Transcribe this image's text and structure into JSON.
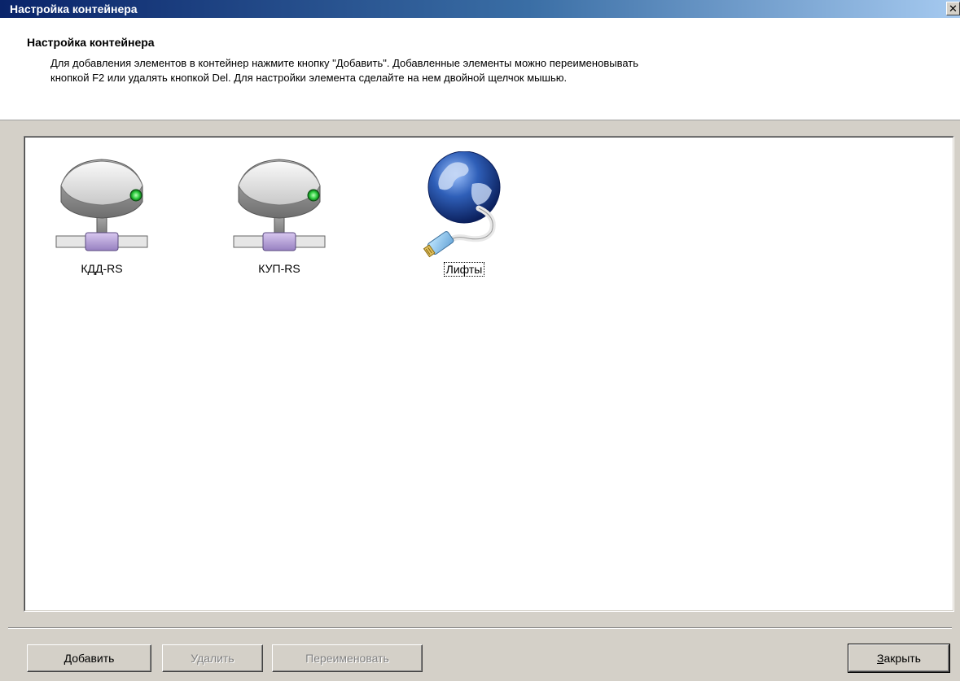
{
  "window": {
    "title": "Настройка контейнера",
    "close_glyph": "✕"
  },
  "header": {
    "title": "Настройка контейнера",
    "desc_line1": "Для добавления элементов в контейнер нажмите кнопку \"Добавить\". Добавленные элементы можно переименовывать",
    "desc_line2": "кнопкой F2 или удалять кнопкой Del. Для настройки элемента сделайте на нем двойной щелчок мышью."
  },
  "items": [
    {
      "label": "КДД-RS",
      "icon": "network-drive-icon"
    },
    {
      "label": "КУП-RS",
      "icon": "network-drive-icon"
    },
    {
      "label": "Лифты",
      "icon": "globe-network-icon",
      "focused": true
    }
  ],
  "buttons": {
    "add": "Добавить",
    "delete": "Удалить",
    "rename": "Переименовать",
    "close": "Закрыть"
  },
  "colors": {
    "title_start": "#0a246a",
    "title_end": "#a6caf0",
    "face": "#d4d0c8",
    "led_green": "#2ecc40"
  }
}
